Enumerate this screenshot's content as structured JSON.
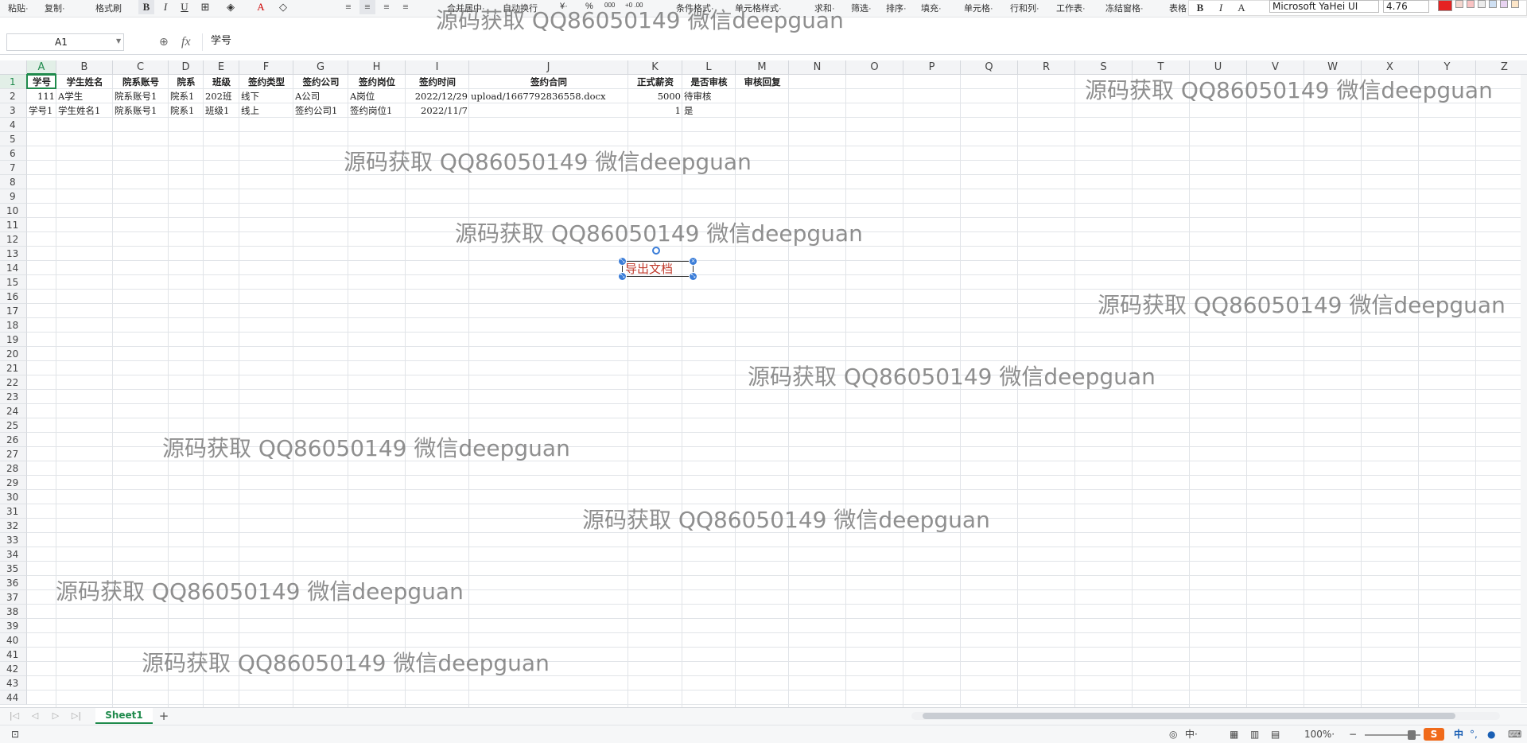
{
  "ribbon": {
    "paste": "粘贴·",
    "copy": "复制·",
    "format_painter": "格式刷",
    "bold": "B",
    "italic": "I",
    "underline": "U",
    "merge_center": "合并居中·",
    "auto_wrap": "自动换行",
    "currency": "¥·",
    "percent": "%",
    "thousands": "000",
    "dec_inc": "+0 .00",
    "dec_dec": ".00 +0",
    "cond_format": "条件格式·",
    "cell_style": "单元格样式·",
    "sum": "求和·",
    "filter": "筛选·",
    "sort": "排序·",
    "fill": "填充·",
    "cell": "单元格·",
    "row_col": "行和列·",
    "worksheet": "工作表·",
    "freeze": "冻结窗格·",
    "table_tools": "表格",
    "mini_bold": "B",
    "mini_italic": "I",
    "mini_a": "A",
    "font_name": "Microsoft YaHei UI",
    "font_size": "4.76",
    "swatch_colors": [
      "#e52222",
      "#f4d6cf",
      "#f9c3c3",
      "#ececec",
      "#cfe0f3",
      "#e8d3f1",
      "#fde6c8"
    ]
  },
  "formula_bar": {
    "name_box": "A1",
    "fx": "fx",
    "value": "学号"
  },
  "columns": [
    {
      "label": "A",
      "w": 37
    },
    {
      "label": "B",
      "w": 71
    },
    {
      "label": "C",
      "w": 70
    },
    {
      "label": "D",
      "w": 44
    },
    {
      "label": "E",
      "w": 45
    },
    {
      "label": "F",
      "w": 68
    },
    {
      "label": "G",
      "w": 69
    },
    {
      "label": "H",
      "w": 72
    },
    {
      "label": "I",
      "w": 80
    },
    {
      "label": "J",
      "w": 200
    },
    {
      "label": "K",
      "w": 68
    },
    {
      "label": "L",
      "w": 67
    },
    {
      "label": "M",
      "w": 67
    },
    {
      "label": "N",
      "w": 72
    },
    {
      "label": "O",
      "w": 72
    },
    {
      "label": "P",
      "w": 72
    },
    {
      "label": "Q",
      "w": 72
    },
    {
      "label": "R",
      "w": 72
    },
    {
      "label": "S",
      "w": 72
    },
    {
      "label": "T",
      "w": 72
    },
    {
      "label": "U",
      "w": 72
    },
    {
      "label": "V",
      "w": 72
    },
    {
      "label": "W",
      "w": 72
    },
    {
      "label": "X",
      "w": 72
    },
    {
      "label": "Y",
      "w": 72
    },
    {
      "label": "Z",
      "w": 72
    }
  ],
  "row_count": 44,
  "rows": [
    [
      "学号",
      "学生姓名",
      "院系账号",
      "院系",
      "班级",
      "签约类型",
      "签约公司",
      "签约岗位",
      "签约时间",
      "签约合同",
      "正式薪资",
      "是否审核",
      "审核回复"
    ],
    [
      "111",
      "A学生",
      "院系账号1",
      "院系1",
      "202班",
      "线下",
      "A公司",
      "A岗位",
      "2022/12/29",
      "upload/1667792836558.docx",
      "5000",
      "待审核",
      ""
    ],
    [
      "学号1",
      "学生姓名1",
      "院系账号1",
      "院系1",
      "班级1",
      "线上",
      "签约公司1",
      "签约岗位1",
      "2022/11/7",
      "",
      "1",
      "是",
      ""
    ]
  ],
  "text_box": {
    "label": "导出文档"
  },
  "watermark": "源码获取 QQ86050149 微信deepguan",
  "sheet_tabs": [
    "Sheet1"
  ],
  "status": {
    "input_mode": "中·",
    "zoom": "100%·",
    "ime_cn": "中",
    "ime_punct": "°,"
  }
}
